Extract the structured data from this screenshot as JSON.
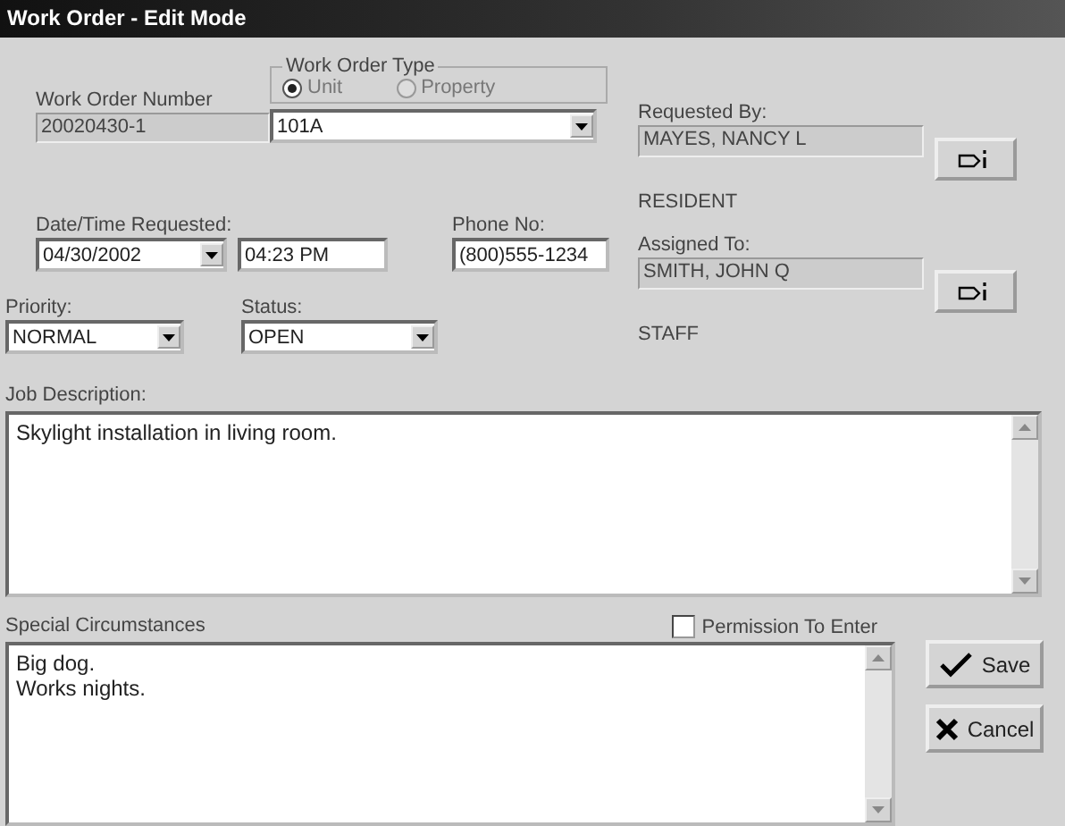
{
  "window": {
    "title": "Work Order - Edit Mode"
  },
  "work_order_number": {
    "label": "Work Order Number",
    "value": "20020430-1"
  },
  "work_order_type": {
    "label": "Work Order Type",
    "disabled": true,
    "options": [
      {
        "label": "Unit",
        "selected": true
      },
      {
        "label": "Property",
        "selected": false
      }
    ],
    "value": "101A"
  },
  "requested_by": {
    "label": "Requested By:",
    "value": "MAYES, NANCY L",
    "role": "RESIDENT"
  },
  "date_time_requested": {
    "label": "Date/Time Requested:",
    "date": "04/30/2002",
    "time": "04:23 PM"
  },
  "phone": {
    "label": "Phone No:",
    "value": "(800)555-1234"
  },
  "assigned_to": {
    "label": "Assigned To:",
    "value": "SMITH, JOHN Q",
    "role": "STAFF"
  },
  "priority": {
    "label": "Priority:",
    "value": "NORMAL"
  },
  "status": {
    "label": "Status:",
    "value": "OPEN"
  },
  "job_description": {
    "label": "Job Description:",
    "value": "Skylight installation in living room."
  },
  "special_circumstances": {
    "label": "Special Circumstances",
    "value": "Big dog.\nWorks nights."
  },
  "permission_to_enter": {
    "label": "Permission To Enter",
    "checked": false
  },
  "buttons": [
    {
      "kind": "save",
      "label": "Save"
    },
    {
      "kind": "cancel",
      "label": "Cancel"
    }
  ]
}
